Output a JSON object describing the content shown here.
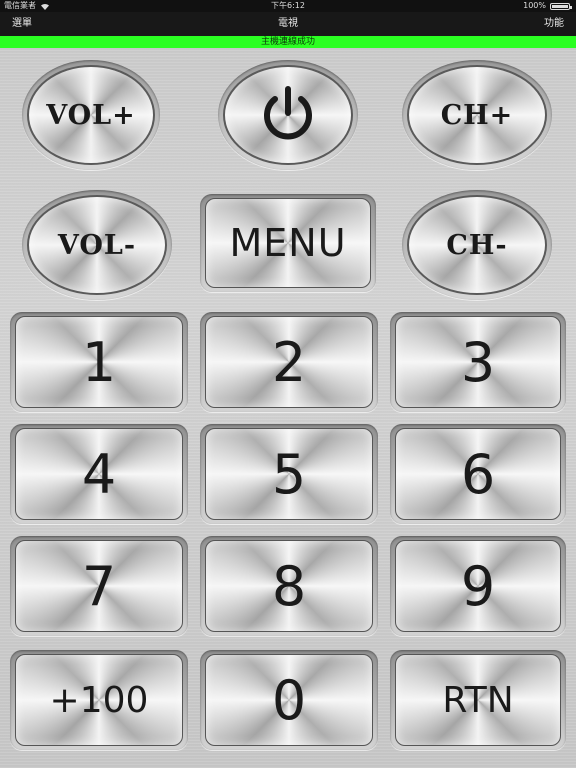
{
  "status_bar": {
    "carrier": "電信業者",
    "time": "下午6:12",
    "battery": "100%"
  },
  "nav": {
    "left": "選單",
    "title": "電視",
    "right": "功能"
  },
  "connection": {
    "message": "主機連線成功",
    "color": "#2bff22"
  },
  "buttons": {
    "vol_up": "VOL+",
    "ch_up": "CH+",
    "vol_down": "VOL-",
    "menu": "MENU",
    "ch_down": "CH-",
    "num_1": "1",
    "num_2": "2",
    "num_3": "3",
    "num_4": "4",
    "num_5": "5",
    "num_6": "6",
    "num_7": "7",
    "num_8": "8",
    "num_9": "9",
    "plus100": "+100",
    "num_0": "0",
    "rtn": "RTN"
  },
  "icons": {
    "power": "power-icon",
    "wifi": "wifi-icon",
    "battery": "battery-icon"
  }
}
